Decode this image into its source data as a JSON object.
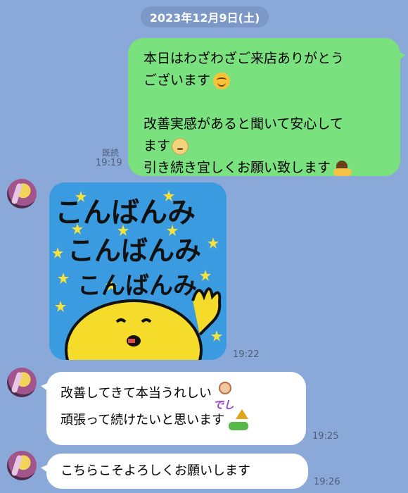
{
  "date_separator": "2023年12月9日(土)",
  "outgoing": {
    "lines": [
      "本日はわざわざご来店ありがとう",
      "ございます",
      "改善実感があると聞いて安心して",
      "ます",
      "引き続き宜しくお願い致します"
    ],
    "emojis": [
      "smiling-face",
      "relieved-face",
      "bowing-person"
    ],
    "read_label": "既読",
    "time": "19:19"
  },
  "incoming": [
    {
      "type": "sticker",
      "sticker_text": [
        "こんばんみ",
        "こんばんみ",
        "こんばんみ"
      ],
      "time": "19:22"
    },
    {
      "type": "text",
      "lines": [
        "改善してきて本当うれしい",
        "頑張って続けたいと思います"
      ],
      "inline_emoji_text": "でし",
      "emojis": [
        "person-de-emoji",
        "up-arrow-emoji"
      ],
      "time": "19:25"
    },
    {
      "type": "text",
      "lines": [
        "こちらこそよろしくお願いします"
      ],
      "time": "19:26"
    }
  ],
  "colors": {
    "background": "#8aa8d8",
    "outgoing_bubble": "#79e17d",
    "incoming_bubble": "#ffffff",
    "sticker_bg": "#3b9be0"
  }
}
